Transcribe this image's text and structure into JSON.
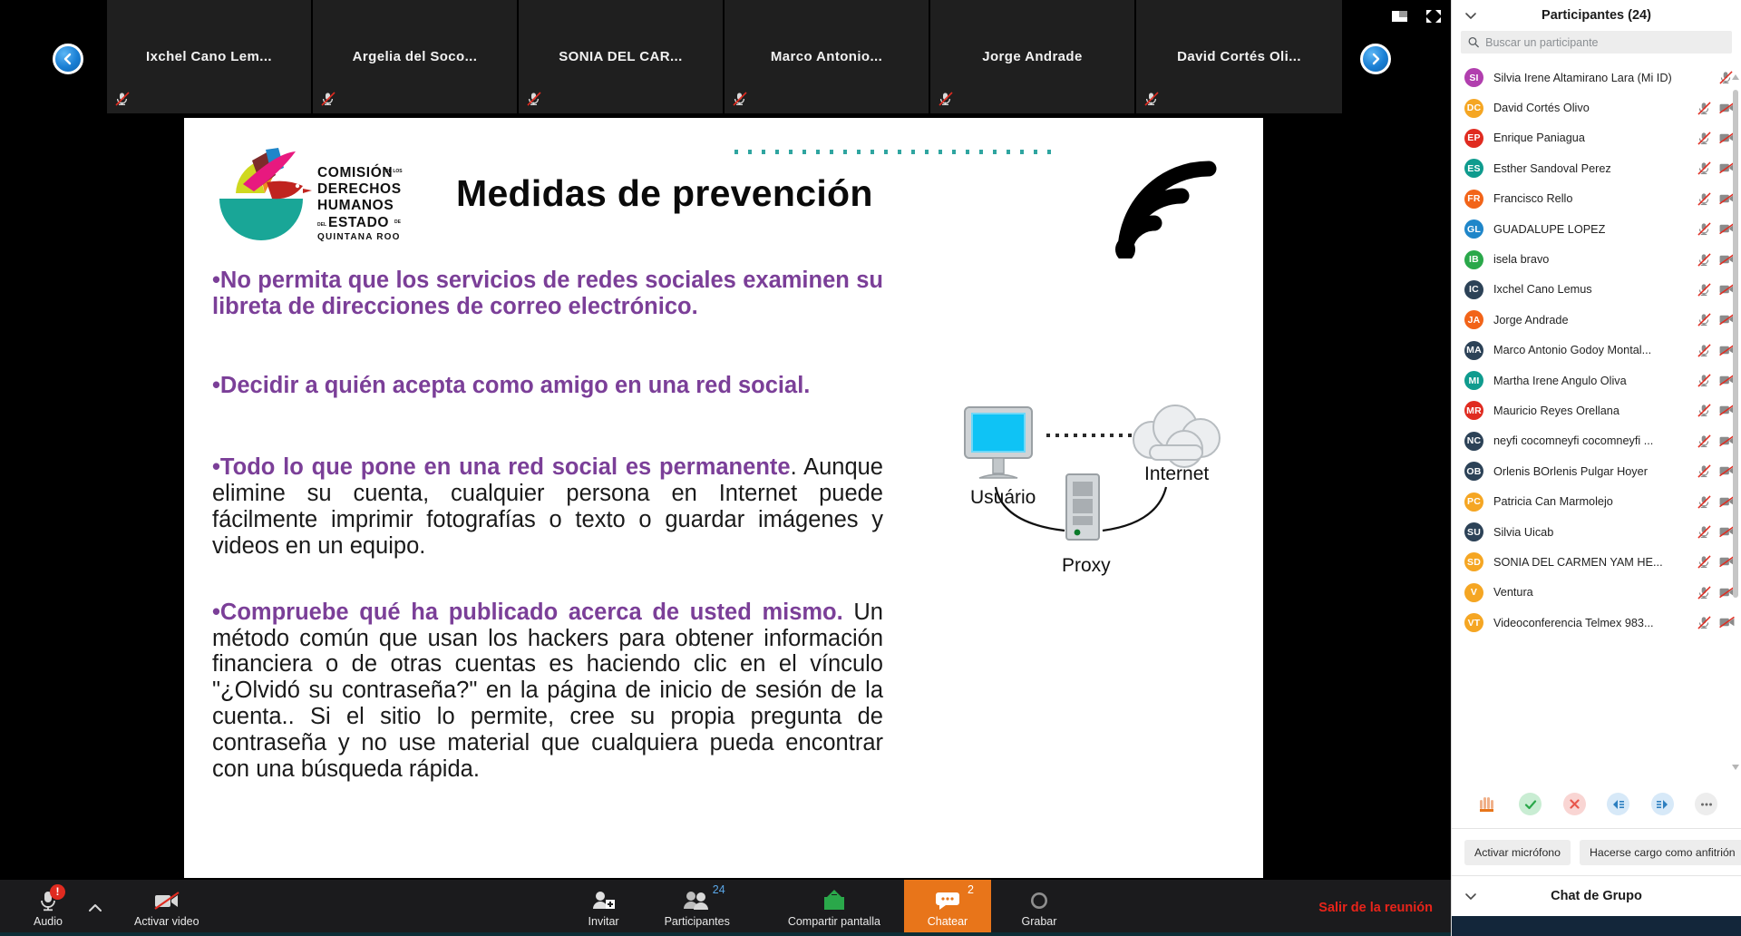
{
  "filmstrip": {
    "prev_icon": "chevron-left-icon",
    "next_icon": "chevron-right-icon",
    "pip_icon": "picture-in-picture-icon",
    "fullscreen_icon": "fullscreen-icon",
    "thumbnails": [
      {
        "name": "Ixchel Cano Lem...",
        "mic": "mic-off-icon"
      },
      {
        "name": "Argelia  del  Soco...",
        "mic": "mic-off-icon"
      },
      {
        "name": "SONIA  DEL CAR...",
        "mic": "mic-off-icon"
      },
      {
        "name": "Marco  Antonio...",
        "mic": "mic-off-icon"
      },
      {
        "name": "Jorge Andrade",
        "mic": "mic-off-icon"
      },
      {
        "name": "David  Cortés  Oli...",
        "mic": "mic-off-icon"
      }
    ]
  },
  "slide": {
    "logo": {
      "line1": "COMISIÓN",
      "line1_sub": "DE LOS",
      "line2": "DERECHOS",
      "line3": "HUMANOS",
      "line4_pre": "DEL",
      "line4": "ESTADO",
      "line4_post": "DE",
      "line5": "QUINTANA ROO"
    },
    "title": "Medidas de prevención",
    "wifi_icon": "wifi-icon",
    "bullets": [
      {
        "id": "b1",
        "style": "all-purple",
        "lead": "•No permita que los servicios de redes sociales examinen su libreta de direcciones de correo electrónico.",
        "rest": ""
      },
      {
        "id": "b2",
        "style": "all-purple",
        "lead": "•Decidir a quién acepta como amigo en una red social.",
        "rest": ""
      },
      {
        "id": "b3",
        "style": "mixed",
        "lead": "•Todo lo que pone en una red social es permanente",
        "rest": ". Aunque elimine su cuenta, cualquier persona en Internet puede fácilmente imprimir fotografías o texto o guardar imágenes y videos en un equipo."
      },
      {
        "id": "b4",
        "style": "mixed",
        "lead": "•Compruebe qué ha publicado acerca de usted mismo.",
        "rest": " Un método común que usan los hackers para obtener información financiera o de otras cuentas es haciendo clic en el vínculo \"¿Olvidó su contraseña?\" en la página de inicio de sesión de la cuenta.. Si el sitio lo permite, cree su propia pregunta de contraseña y no use material que cualquiera pueda encontrar con una búsqueda rápida."
      }
    ],
    "diagram": {
      "user_label": "Usuário",
      "proxy_label": "Proxy",
      "internet_label": "Internet",
      "monitor_icon": "monitor-icon",
      "server_icon": "server-icon",
      "cloud_icon": "cloud-icon"
    }
  },
  "toolbar": {
    "audio": {
      "label": "Audio",
      "icon": "microphone-icon",
      "alert": "!"
    },
    "audio_chevron_icon": "chevron-up-icon",
    "video": {
      "label": "Activar video",
      "icon": "camera-off-icon"
    },
    "invite": {
      "label": "Invitar",
      "icon": "add-person-icon"
    },
    "participants": {
      "label": "Participantes",
      "icon": "people-icon",
      "count": "24"
    },
    "share": {
      "label": "Compartir pantalla",
      "icon": "share-screen-icon"
    },
    "chat": {
      "label": "Chatear",
      "icon": "chat-bubble-icon",
      "count": "2"
    },
    "record": {
      "label": "Grabar",
      "icon": "record-circle-icon"
    },
    "leave": {
      "label": "Salir de la reunión"
    }
  },
  "panel": {
    "collapse_icon": "chevron-down-icon",
    "title": "Participantes (24)",
    "search": {
      "icon": "search-icon",
      "placeholder": "Buscar un participante",
      "value": ""
    },
    "scroll_up_icon": "scroll-up-arrow-icon",
    "scroll_down_icon": "scroll-down-arrow-icon",
    "participants": [
      {
        "initials": "SI",
        "color": "#b13fae",
        "name": "Silvia Irene Altamirano Lara (Mi ID)",
        "mic": "mic-off-icon",
        "cam": ""
      },
      {
        "initials": "DC",
        "color": "#f5a623",
        "name": "David Cortés Olivo",
        "mic": "mic-off-icon",
        "cam": "camera-off-icon"
      },
      {
        "initials": "EP",
        "color": "#e02b20",
        "name": "Enrique Paniagua",
        "mic": "mic-off-icon",
        "cam": "camera-off-icon"
      },
      {
        "initials": "ES",
        "color": "#0f9b8e",
        "name": "Esther Sandoval Perez",
        "mic": "mic-off-icon",
        "cam": "camera-off-icon"
      },
      {
        "initials": "FR",
        "color": "#f26419",
        "name": "Francisco Rello",
        "mic": "mic-off-icon",
        "cam": "camera-off-icon"
      },
      {
        "initials": "GL",
        "color": "#1f86c9",
        "name": "GUADALUPE LOPEZ",
        "mic": "mic-off-icon",
        "cam": "camera-off-icon"
      },
      {
        "initials": "IB",
        "color": "#2aa84a",
        "name": "isela bravo",
        "mic": "mic-off-icon",
        "cam": "camera-off-icon"
      },
      {
        "initials": "IC",
        "color": "#2c4257",
        "name": "Ixchel Cano Lemus",
        "mic": "mic-off-icon",
        "cam": "camera-off-icon"
      },
      {
        "initials": "JA",
        "color": "#f26419",
        "name": "Jorge Andrade",
        "mic": "mic-off-icon",
        "cam": "camera-off-icon"
      },
      {
        "initials": "MA",
        "color": "#2c4257",
        "name": "Marco Antonio Godoy Montal...",
        "mic": "mic-off-icon",
        "cam": "camera-off-icon"
      },
      {
        "initials": "MI",
        "color": "#0f9b8e",
        "name": "Martha Irene Angulo Oliva",
        "mic": "mic-off-icon",
        "cam": "camera-off-icon"
      },
      {
        "initials": "MR",
        "color": "#e02b20",
        "name": "Mauricio Reyes Orellana",
        "mic": "mic-off-icon",
        "cam": "camera-off-icon"
      },
      {
        "initials": "NC",
        "color": "#2c4257",
        "name": "neyfi cocomneyfi cocomneyfi ...",
        "mic": "mic-off-icon",
        "cam": "camera-off-icon"
      },
      {
        "initials": "OB",
        "color": "#2c4257",
        "name": "Orlenis BOrlenis Pulgar Hoyer",
        "mic": "mic-off-icon",
        "cam": "camera-off-icon"
      },
      {
        "initials": "PC",
        "color": "#f5a623",
        "name": "Patricia Can Marmolejo",
        "mic": "mic-off-icon",
        "cam": "camera-off-icon"
      },
      {
        "initials": "SU",
        "color": "#2c4257",
        "name": "Silvia Uicab",
        "mic": "mic-off-icon",
        "cam": "camera-off-icon"
      },
      {
        "initials": "SD",
        "color": "#f5a623",
        "name": "SONIA DEL CARMEN YAM HE...",
        "mic": "mic-off-icon",
        "cam": "camera-off-icon"
      },
      {
        "initials": "V",
        "color": "#f5a623",
        "name": "Ventura",
        "mic": "mic-off-icon",
        "cam": "camera-off-icon"
      },
      {
        "initials": "VT",
        "color": "#f5a623",
        "name": "Videoconferencia Telmex 983...",
        "mic": "mic-off-icon",
        "cam": "camera-off-icon"
      }
    ],
    "reactions": [
      {
        "name": "raise-hand-icon"
      },
      {
        "name": "yes-check-icon"
      },
      {
        "name": "no-cross-icon"
      },
      {
        "name": "slower-icon"
      },
      {
        "name": "faster-icon"
      },
      {
        "name": "more-reactions-icon"
      }
    ],
    "actions": [
      {
        "label": "Activar micrófono"
      },
      {
        "label": "Hacerse cargo como anfitrión"
      }
    ],
    "chat": {
      "collapse_icon": "chevron-down-icon",
      "title": "Chat de Grupo"
    }
  },
  "colors": {
    "accent_purple": "#7B3F98",
    "chat_orange": "#e8751a",
    "leave_red": "#e8241a",
    "share_green": "#2aa84a"
  }
}
